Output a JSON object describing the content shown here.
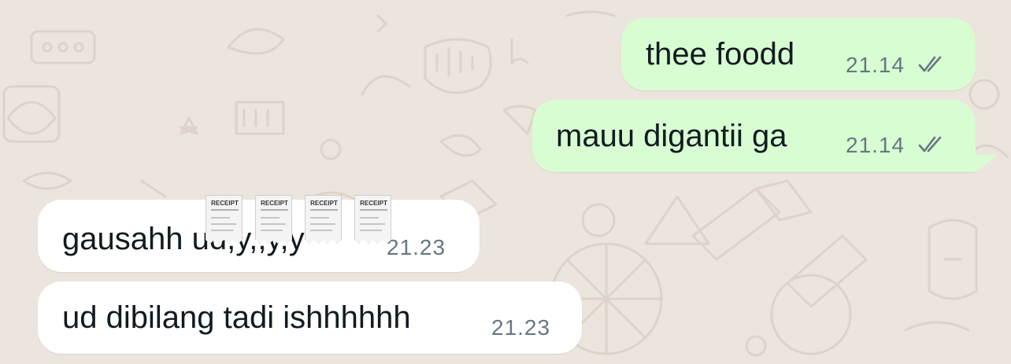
{
  "colors": {
    "chat_background": "#ece5dd",
    "outgoing_bubble": "#d9fdd3",
    "incoming_bubble": "#ffffff",
    "message_text": "#111b21",
    "meta_text": "#667781"
  },
  "messages": [
    {
      "direction": "outgoing",
      "text": "thee foodd",
      "time": "21.14",
      "status_icon": "double-check-icon"
    },
    {
      "direction": "outgoing",
      "text": "mauu digantii ga",
      "time": "21.14",
      "status_icon": "double-check-icon"
    },
    {
      "direction": "incoming",
      "text": "gausahh ud,y,,y,y",
      "time": "21.23",
      "emoji": "receipt-emoji",
      "emoji_label": "RECEIPT"
    },
    {
      "direction": "incoming",
      "text": "ud dibilang tadi ishhhhhh",
      "time": "21.23"
    }
  ]
}
